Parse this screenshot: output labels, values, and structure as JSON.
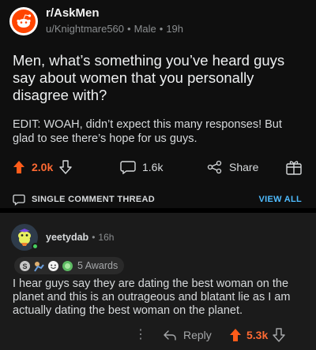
{
  "post": {
    "subreddit": "r/AskMen",
    "author": "u/Knightmare560",
    "flair": "Male",
    "age": "19h",
    "title": "Men, what’s something you’ve heard guys say about women that you personally disagree with?",
    "body": "EDIT: WOAH, didn’t expect this many responses! But glad to see there’s hope for us guys.",
    "upvotes": "2.0k",
    "comments": "1.6k",
    "share_label": "Share"
  },
  "thread": {
    "label": "SINGLE COMMENT THREAD",
    "view_all": "VIEW ALL"
  },
  "comment": {
    "author": "yeetydab",
    "age": "16h",
    "awards_label": "5 Awards",
    "body": "I hear guys say they are dating the best woman on the planet and this is an outrageous and blatant lie as I am actually dating the best woman on the planet.",
    "reply_label": "Reply",
    "score": "5.3k"
  },
  "colors": {
    "upvote": "#ff5c1a",
    "link": "#4fbcff",
    "background": "#0f0f0f",
    "comment_background": "#1b1b1b"
  },
  "icons": [
    "reddit-alien-icon",
    "upvote-arrow-icon",
    "downvote-arrow-icon",
    "comment-bubble-icon",
    "share-icon",
    "give-award-icon",
    "reply-icon",
    "more-dots-icon"
  ]
}
